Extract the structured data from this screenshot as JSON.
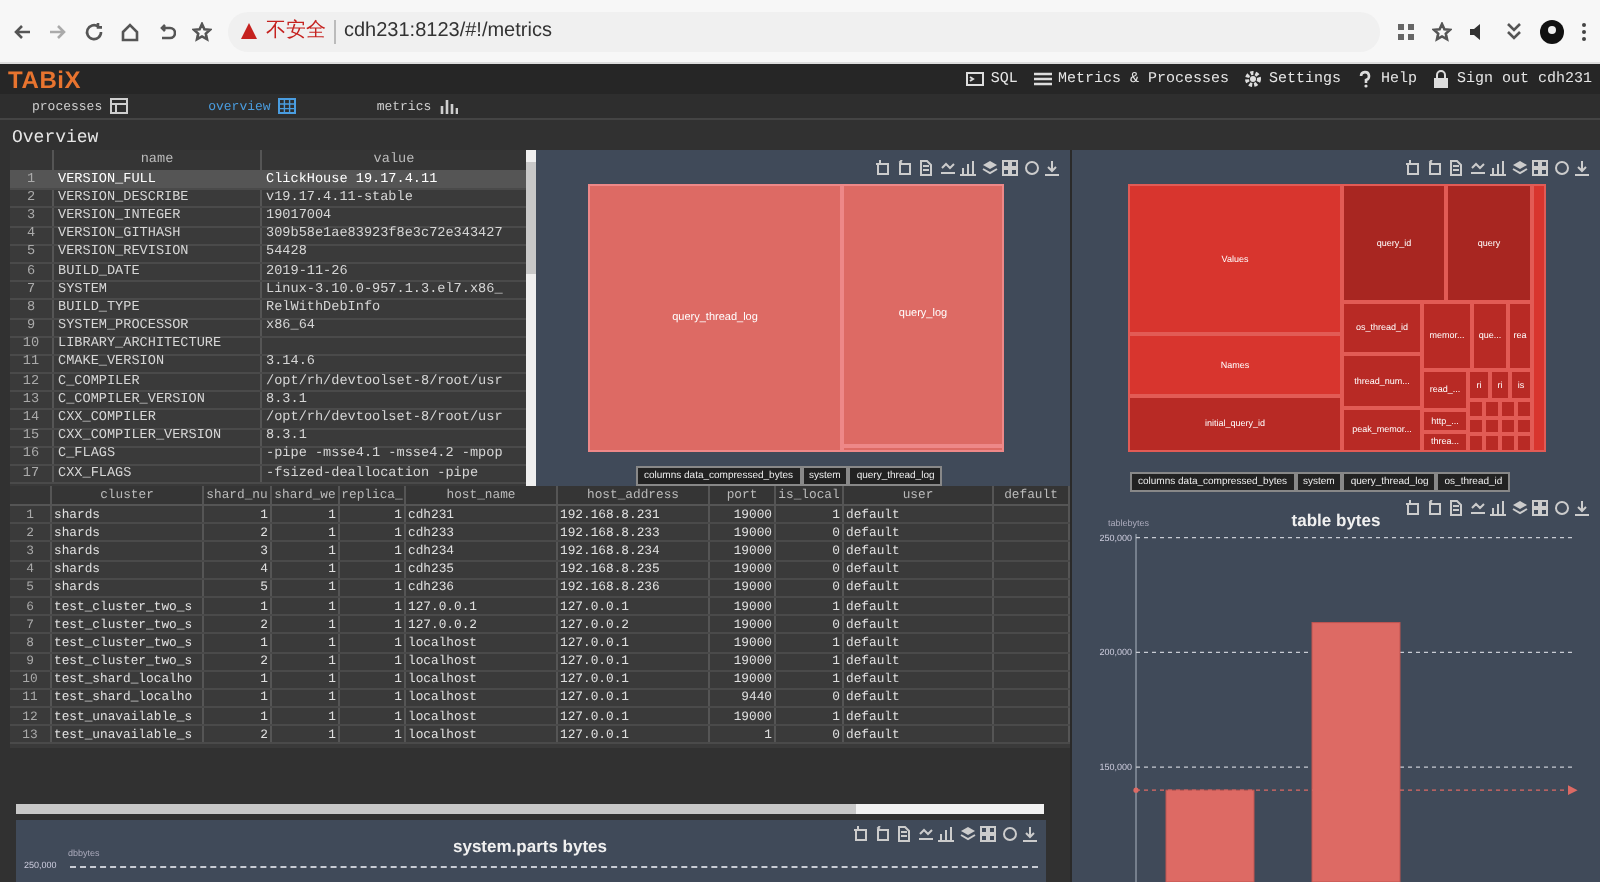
{
  "browser": {
    "security": "不安全",
    "url": "cdh231:8123/#!/metrics"
  },
  "header": {
    "logo": "TABiX",
    "menu": [
      {
        "kind": "sql",
        "label": "SQL"
      },
      {
        "kind": "list",
        "label": "Metrics & Processes"
      },
      {
        "kind": "settings",
        "label": "Settings"
      },
      {
        "kind": "help",
        "label": "Help"
      },
      {
        "kind": "lock",
        "label": "Sign out cdh231"
      }
    ]
  },
  "tabs": [
    {
      "label": "processes",
      "kind": "table",
      "selected": false
    },
    {
      "label": "overview",
      "kind": "grid",
      "selected": true
    },
    {
      "label": "metrics",
      "kind": "chart",
      "selected": false
    }
  ],
  "page_title": "Overview",
  "build_table": {
    "columns": [
      "name",
      "value"
    ],
    "rows": [
      {
        "index": "1",
        "name": "VERSION_FULL",
        "value": "ClickHouse 19.17.4.11",
        "selected": true
      },
      {
        "index": "2",
        "name": "VERSION_DESCRIBE",
        "value": "v19.17.4.11-stable",
        "selected": false
      },
      {
        "index": "3",
        "name": "VERSION_INTEGER",
        "value": "19017004",
        "selected": false
      },
      {
        "index": "4",
        "name": "VERSION_GITHASH",
        "value": "309b58e1ae83923f8e3c72e343427",
        "selected": false
      },
      {
        "index": "5",
        "name": "VERSION_REVISION",
        "value": "54428",
        "selected": false
      },
      {
        "index": "6",
        "name": "BUILD_DATE",
        "value": "2019-11-26",
        "selected": false
      },
      {
        "index": "7",
        "name": "SYSTEM",
        "value": "Linux-3.10.0-957.1.3.el7.x86_",
        "selected": false
      },
      {
        "index": "8",
        "name": "BUILD_TYPE",
        "value": "RelWithDebInfo",
        "selected": false
      },
      {
        "index": "9",
        "name": "SYSTEM_PROCESSOR",
        "value": "x86_64",
        "selected": false
      },
      {
        "index": "10",
        "name": "LIBRARY_ARCHITECTURE",
        "selected": false
      },
      {
        "index": "11",
        "name": "CMAKE_VERSION",
        "value": "3.14.6",
        "selected": false
      },
      {
        "index": "12",
        "name": "C_COMPILER",
        "value": "/opt/rh/devtoolset-8/root/usr",
        "selected": false
      },
      {
        "index": "13",
        "name": "C_COMPILER_VERSION",
        "value": "8.3.1",
        "selected": false
      },
      {
        "index": "14",
        "name": "CXX_COMPILER",
        "value": "/opt/rh/devtoolset-8/root/usr",
        "selected": false
      },
      {
        "index": "15",
        "name": "CXX_COMPILER_VERSION",
        "value": "8.3.1",
        "selected": false
      },
      {
        "index": "16",
        "name": "C_FLAGS",
        "value": "-pipe -msse4.1 -msse4.2 -mpop",
        "selected": false
      },
      {
        "index": "17",
        "name": "CXX_FLAGS",
        "value": "-fsized-deallocation -pipe",
        "selected": false
      }
    ]
  },
  "cluster_table": {
    "columns": [
      "cluster",
      "shard_nu",
      "shard_we",
      "replica_",
      "host_name",
      "host_address",
      "port",
      "is_local",
      "user",
      "default"
    ],
    "rows": [
      {
        "index": "1",
        "cells": [
          "shards",
          "1",
          "1",
          "1",
          "cdh231",
          "192.168.8.231",
          "19000",
          "1",
          "default"
        ]
      },
      {
        "index": "2",
        "cells": [
          "shards",
          "2",
          "1",
          "1",
          "cdh233",
          "192.168.8.233",
          "19000",
          "0",
          "default"
        ]
      },
      {
        "index": "3",
        "cells": [
          "shards",
          "3",
          "1",
          "1",
          "cdh234",
          "192.168.8.234",
          "19000",
          "0",
          "default"
        ]
      },
      {
        "index": "4",
        "cells": [
          "shards",
          "4",
          "1",
          "1",
          "cdh235",
          "192.168.8.235",
          "19000",
          "0",
          "default"
        ]
      },
      {
        "index": "5",
        "cells": [
          "shards",
          "5",
          "1",
          "1",
          "cdh236",
          "192.168.8.236",
          "19000",
          "0",
          "default"
        ]
      },
      {
        "index": "6",
        "cells": [
          "test_cluster_two_s",
          "1",
          "1",
          "1",
          "127.0.0.1",
          "127.0.0.1",
          "19000",
          "1",
          "default"
        ]
      },
      {
        "index": "7",
        "cells": [
          "test_cluster_two_s",
          "2",
          "1",
          "1",
          "127.0.0.2",
          "127.0.0.2",
          "19000",
          "0",
          "default"
        ]
      },
      {
        "index": "8",
        "cells": [
          "test_cluster_two_s",
          "1",
          "1",
          "1",
          "localhost",
          "127.0.0.1",
          "19000",
          "1",
          "default"
        ]
      },
      {
        "index": "9",
        "cells": [
          "test_cluster_two_s",
          "2",
          "1",
          "1",
          "localhost",
          "127.0.0.1",
          "19000",
          "1",
          "default"
        ]
      },
      {
        "index": "10",
        "cells": [
          "test_shard_localho",
          "1",
          "1",
          "1",
          "localhost",
          "127.0.0.1",
          "19000",
          "1",
          "default"
        ]
      },
      {
        "index": "11",
        "cells": [
          "test_shard_localho",
          "1",
          "1",
          "1",
          "localhost",
          "127.0.0.1",
          "9440",
          "0",
          "default"
        ]
      },
      {
        "index": "12",
        "cells": [
          "test_unavailable_s",
          "1",
          "1",
          "1",
          "localhost",
          "127.0.0.1",
          "19000",
          "1",
          "default"
        ]
      },
      {
        "index": "13",
        "cells": [
          "test_unavailable_s",
          "2",
          "1",
          "1",
          "localhost",
          "127.0.0.1",
          "1",
          "0",
          "default"
        ]
      }
    ]
  },
  "tables_treemap": {
    "cells": [
      "query_thread_log",
      "query_log"
    ],
    "breadcrumb": [
      "columns data_compressed_bytes",
      "system",
      "query_thread_log"
    ]
  },
  "columns_treemap": {
    "cells": [
      {
        "label": "Values",
        "color": "#d8352e"
      },
      {
        "label": "Names",
        "color": "#d8352e"
      },
      {
        "label": "initial_query_id",
        "color": "#b82a25"
      },
      {
        "label": "query_id",
        "color": "#a82621"
      },
      {
        "label": "query",
        "color": "#a82621"
      },
      {
        "label": "os_thread_id",
        "color": "#b82a25"
      },
      {
        "label": "thread_num...",
        "color": "#b82a25"
      },
      {
        "label": "peak_memor...",
        "color": "#b82a25"
      },
      {
        "label": "memor...",
        "color": "#b82a25"
      },
      {
        "label": "que...",
        "color": "#b82a25"
      },
      {
        "label": "rea",
        "color": "#b82a25"
      },
      {
        "label": "read_...",
        "color": "#b82a25"
      },
      {
        "label": "http_...",
        "color": "#b82a25"
      },
      {
        "label": "threa...",
        "color": "#b82a25"
      },
      {
        "label": "ri",
        "color": "#b82a25"
      },
      {
        "label": "ri",
        "color": "#b82a25"
      },
      {
        "label": "is",
        "color": "#b82a25"
      }
    ],
    "breadcrumb": [
      "columns data_compressed_bytes",
      "system",
      "query_thread_log",
      "os_thread_id"
    ]
  },
  "parts_chart": {
    "title": "system.parts bytes",
    "ylabel": "dbbytes",
    "ytick": "250,000"
  },
  "table_bytes": {
    "chart_data": {
      "type": "bar",
      "title": "table bytes",
      "ylabel": "tablebytes",
      "values": [
        140000,
        213000
      ],
      "ylim": [
        100000,
        269000
      ],
      "grid": true,
      "yticks": [
        {
          "value": 150000,
          "label": "150,000"
        },
        {
          "value": 200000,
          "label": "200,000"
        },
        {
          "value": 250000,
          "label": "250,000"
        }
      ],
      "ref_lines": [
        {
          "axis": "y",
          "value": 140000
        }
      ]
    }
  }
}
